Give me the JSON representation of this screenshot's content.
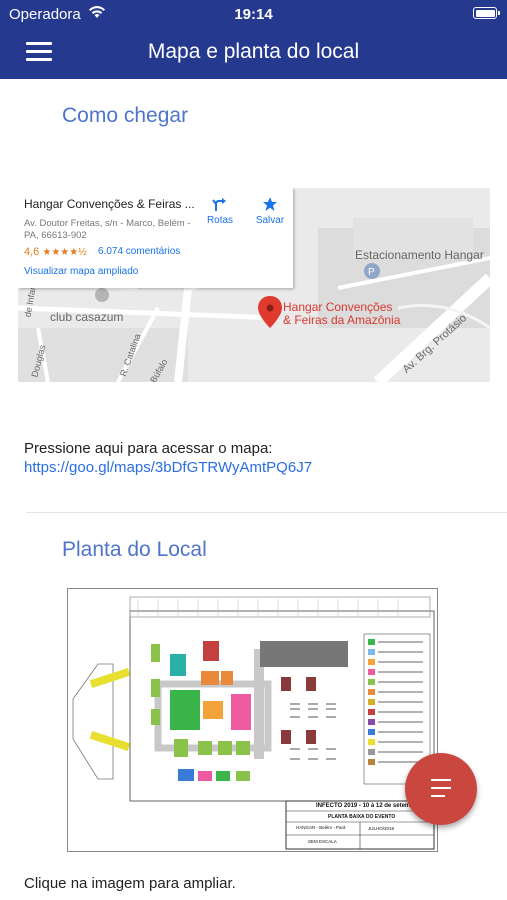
{
  "status": {
    "carrier": "Operadora",
    "time": "19:14",
    "icons": [
      "wifi-icon",
      "battery-icon"
    ]
  },
  "header": {
    "title": "Mapa e planta do local",
    "menu_icon": "hamburger-icon"
  },
  "directions": {
    "heading": "Como chegar",
    "map": {
      "place_name": "Hangar Convenções & Feiras ...",
      "address": "Av. Doutor Freitas, s/n - Marco, Belém - PA, 66613-902",
      "rating": "4,6",
      "stars": "★★★★½",
      "reviews": "6.074 comentários",
      "view_larger": "Visualizar mapa ampliado",
      "directions_label": "Rotas",
      "save_label": "Salvar",
      "labels": {
        "parking": "Estacionamento Hangar",
        "club": "club casazum",
        "pin_line1": "Hangar Convenções",
        "pin_line2": "& Feiras da Amazônia",
        "street1": "R. Catalina",
        "street2": "Av. Brg. Protásio",
        "street3": "Búfalo",
        "street4": "Douglas",
        "street5": "de Infan"
      }
    },
    "press_text": "Pressione aqui para acessar o mapa:",
    "map_link": "https://goo.gl/maps/3bDfGTRWyAmtPQ6J7"
  },
  "plan": {
    "heading": "Planta do Local",
    "title_block": {
      "event": "INFECTO 2019 - 10 à 12 de setembro",
      "subtitle": "PLANTA BAIXA DO EVENTO",
      "venue": "HANGAR - Belém - Pará",
      "date": "JULHO/2019",
      "scale": "SEM ESCALA"
    },
    "legend_colors": [
      "#3ab54a",
      "#7db8e8",
      "#f4a33b",
      "#ee5aa0",
      "#8bc34a",
      "#e8893b",
      "#d4b028",
      "#c44040",
      "#8a4aa8",
      "#3a7bd5",
      "#e8e030",
      "#999999",
      "#b8863b"
    ],
    "hint": "Clique na imagem para ampliar."
  },
  "fab": {
    "icon": "list-icon"
  },
  "colors": {
    "primary": "#253a8e",
    "accent": "#4f74c9",
    "fab": "#c9473f",
    "link": "#2b6de4"
  }
}
